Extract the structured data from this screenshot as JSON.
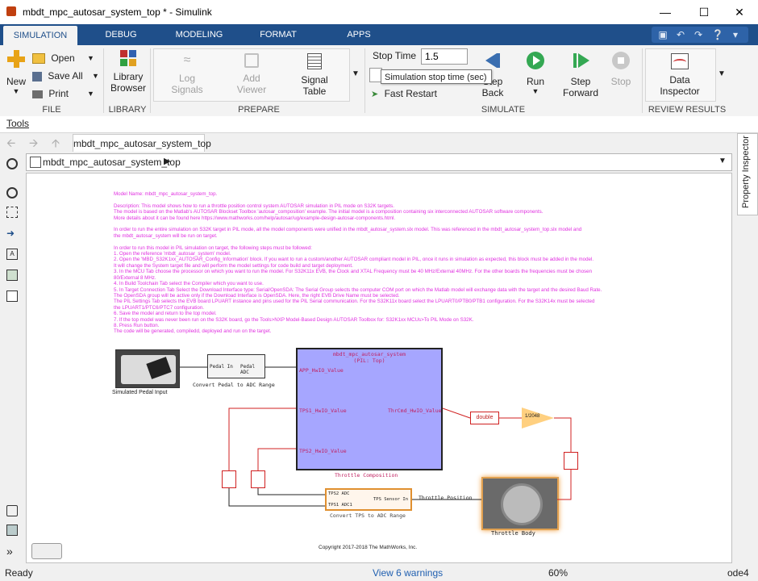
{
  "window": {
    "title": "mbdt_mpc_autosar_system_top * - Simulink"
  },
  "ribbon_tabs": [
    "SIMULATION",
    "DEBUG",
    "MODELING",
    "FORMAT",
    "APPS"
  ],
  "file": {
    "new": "New",
    "open": "Open",
    "save_all": "Save All",
    "print": "Print",
    "group": "FILE"
  },
  "library": {
    "browser_line1": "Library",
    "browser_line2": "Browser",
    "group": "LIBRARY"
  },
  "prepare": {
    "log_line1": "Log",
    "log_line2": "Signals",
    "add_line1": "Add",
    "add_line2": "Viewer",
    "table_line1": "Signal",
    "table_line2": "Table",
    "group": "PREPARE"
  },
  "simulate": {
    "stop_time_label": "Stop Time",
    "stop_time_value": "1.5",
    "tooltip": "Simulation stop time (sec)",
    "fast_restart": "Fast Restart",
    "step_back_line1": "Step",
    "step_back_line2": "Back",
    "run": "Run",
    "step_fwd_line1": "Step",
    "step_fwd_line2": "Forward",
    "stop": "Stop",
    "group": "SIMULATE"
  },
  "review": {
    "inspector_line1": "Data",
    "inspector_line2": "Inspector",
    "group": "REVIEW RESULTS"
  },
  "tools_menu": "Tools",
  "nav_tab": "mbdt_mpc_autosar_system_top",
  "breadcrumb": "mbdt_mpc_autosar_system_top",
  "property_inspector": "Property Inspector",
  "model_text": [
    "Model Name: mbdt_mpc_autosar_system_top.",
    "",
    "Description: This model shows how to run a throttle position control system AUTOSAR simulation in PIL mode on S32K targets.",
    "The model is based on the Matlab's AUTOSAR Blockset Toolbox 'autosar_composition' example. The initial model is a composition containing six interconnected AUTOSAR software components.",
    "More details about it can be found here https://www.mathworks.com/help/autosar/ug/example-design-autosar-components.html.",
    "",
    "In order to run the entire simulation on S32K target in PIL mode, all the model components were unified in the mbdt_autosar_system.slx model. This was referenced in the mbdt_autosar_system_top.slx model and",
    "the mbdt_autosar_system will be run on target.",
    "",
    "In order to run this model in PIL simulation on target, the following steps must be followed:",
    "1. Open the reference 'mbdt_autosar_system' model.",
    "2. Open the 'MBD_S32K1xx_AUTOSAR_Config_Information' block. If you want to run a custom/another AUTOSAR compliant model in PIL, once it runs in simulation as expected, this block must be added in the model.",
    "It will change the System target file and will perform the model settings for code build and target deployment.",
    "3. In the MCU Tab choose the processor on which you want to run the model. For S32K11x EVB, the Clock and XTAL Frequency must be 40 MHz/External 40MHz. For the other boards the frequencies must be chosen",
    "80/External 8 MHz.",
    "4. In Build Toolchain Tab select the Compiler which you want to use.",
    "5. In Target Connection Tab Select the Download Interface type: Serial/OpenSDA: The Serial Group selects the computer COM port on which the Matlab model will exchange data with the target and the desired Baud Rate.",
    "The OpenSDA group will be active only if the Download Interface is OpenSDA. Here, the right EVB Drive Name must be selected.",
    "The PIL Settings Tab selects the EVB board LPUART instance and pins used for the PIL Serial communication. For the S32K11x board select the LPUART0/PTB0/PTB1 configuration. For the S32K14x must be selected",
    "the LPUART1/PTC6/PTC7 configuration.",
    "6. Save the model and return to the top model.",
    "7. If the top model was never been run on the S32K board, go the Tools>NXP Model-Based Design AUTOSAR Toolbox for: S32K1xx MCUs>To PIL Mode on S32K.",
    "8. Press Run button.",
    "The code will be generated, compiledd, deployed and run on the target."
  ],
  "diagram": {
    "pedal_input": "Simulated Pedal Input",
    "convert_pedal": {
      "in": "Pedal In",
      "out": "Pedal ADC",
      "label": "Convert Pedal to ADC Range"
    },
    "composition": {
      "title_line1": "mbdt_mpc_autosar_system",
      "title_line2": "(PIL: Top)",
      "port_app": "APP_HwIO_Value",
      "port_tps1": "TPS1_HwIO_Value",
      "port_tps2": "TPS2_HwIO_Value",
      "port_out": "ThrCmd_HwIO_Value",
      "label": "Throttle Composition"
    },
    "double": "double",
    "gain": "1/2048",
    "convert_tps": {
      "in1": "TPS2 ADC",
      "in2": "TPS1 ADC1",
      "out": "TPS Sensor In",
      "label": "Convert TPS to ADC Range"
    },
    "throttle_position": "Throttle Position",
    "throttle_body": "Throttle Body",
    "copyright": "Copyright 2017-2018 The MathWorks, Inc."
  },
  "status": {
    "left": "Ready",
    "warnings": "View 6 warnings",
    "zoom": "60%",
    "solver": "ode4"
  }
}
